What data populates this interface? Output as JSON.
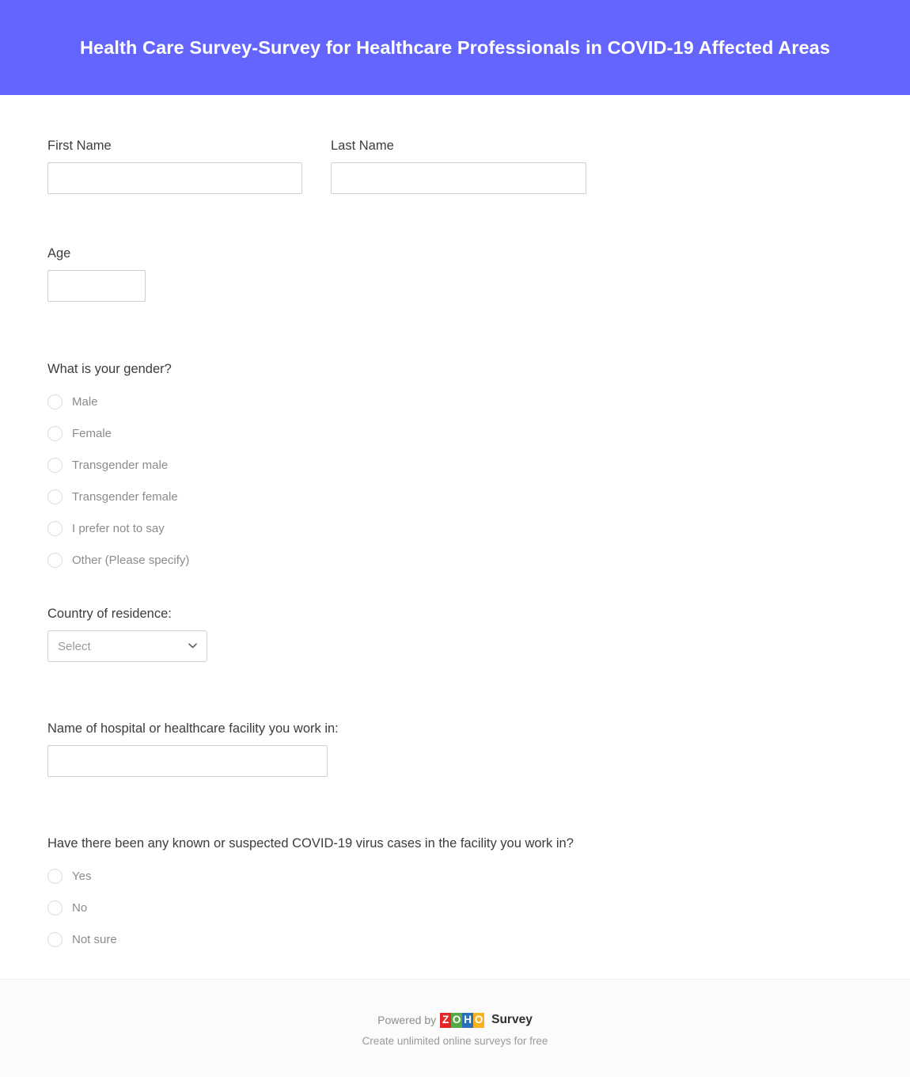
{
  "header": {
    "title": "Health Care Survey-Survey for Healthcare Professionals in COVID-19 Affected Areas",
    "background_color": "#6365fc",
    "text_color": "#ffffff"
  },
  "form": {
    "first_name": {
      "label": "First Name",
      "value": "",
      "placeholder": ""
    },
    "last_name": {
      "label": "Last Name",
      "value": "",
      "placeholder": ""
    },
    "age": {
      "label": "Age",
      "value": "",
      "placeholder": ""
    },
    "gender": {
      "label": "What is your gender?",
      "options": [
        "Male",
        "Female",
        "Transgender male",
        "Transgender female",
        "I prefer not to say",
        "Other (Please specify)"
      ]
    },
    "country": {
      "label": "Country of residence:",
      "selected": "Select",
      "icon": "chevron-down-icon"
    },
    "facility_name": {
      "label": "Name of hospital or healthcare facility you work in:",
      "value": "",
      "placeholder": ""
    },
    "covid_cases": {
      "label": "Have there been any known or suspected COVID-19 virus cases in the facility you work in?",
      "options": [
        "Yes",
        "No",
        "Not sure"
      ]
    }
  },
  "footer": {
    "powered_by": "Powered by",
    "brand_tiles": [
      "Z",
      "O",
      "H",
      "O"
    ],
    "brand_suffix": "Survey",
    "tagline": "Create unlimited online surveys for free",
    "tile_colors": [
      "#e42527",
      "#57a948",
      "#2a6fb8",
      "#f9b21d"
    ]
  }
}
